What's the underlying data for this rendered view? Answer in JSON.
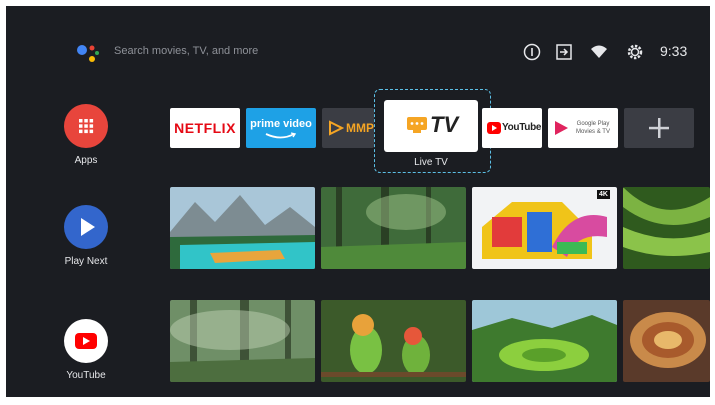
{
  "search": {
    "placeholder": "Search movies, TV, and more"
  },
  "status": {
    "clock": "9:33"
  },
  "rail": {
    "apps_label": "Apps",
    "play_next_label": "Play Next",
    "youtube_label": "YouTube"
  },
  "apps": {
    "netflix": "NETFLIX",
    "prime_line1": "prime video",
    "mmp": "MMP",
    "livetv_logo": "TV",
    "livetv_caption": "Live TV",
    "youtube": "YouTube",
    "gplay_line1": "Google Play",
    "gplay_line2": "Movies & TV"
  },
  "badges": {
    "four_k": "4K"
  },
  "colors": {
    "background": "#1b1d22",
    "apps_red": "#e8453c",
    "play_next_blue": "#3366cc",
    "youtube_red": "#ff0000",
    "netflix_red": "#e50914",
    "prime_blue": "#1ea1e6",
    "focus_outline": "#5cc0e6"
  },
  "icons": [
    "assistant-icon",
    "info-icon",
    "input-icon",
    "wifi-icon",
    "settings-icon",
    "apps-grid-icon",
    "play-icon",
    "youtube-play-icon",
    "add-icon"
  ]
}
